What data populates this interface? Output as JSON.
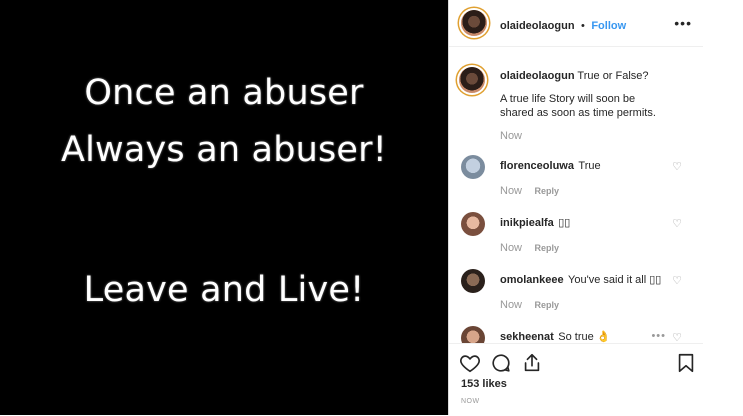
{
  "post": {
    "image_lines": [
      "Once an abuser",
      "Always an abuser!",
      "Leave and Live!"
    ]
  },
  "header": {
    "username": "olaideolaogun",
    "separator": "•",
    "follow_label": "Follow",
    "more_label": "•••"
  },
  "caption": {
    "username": "olaideolaogun",
    "text": "True or False?",
    "body": "A true life Story will soon be shared as soon as time permits.",
    "time": "Now"
  },
  "comments": [
    {
      "username": "florenceoluwa",
      "text": "True",
      "time": "Now",
      "reply_label": "Reply"
    },
    {
      "username": "inikpiealfa",
      "text": "▯▯",
      "time": "Now",
      "reply_label": "Reply"
    },
    {
      "username": "omolankeee",
      "text": "You've said it all ▯▯",
      "time": "Now",
      "reply_label": "Reply"
    },
    {
      "username": "sekheenat",
      "text": "So true 👌",
      "time": "",
      "reply_label": ""
    }
  ],
  "footer": {
    "likes": "153 likes",
    "timestamp": "NOW"
  },
  "icons": {
    "like": "heart-icon",
    "comment": "comment-icon",
    "share": "share-icon",
    "save": "bookmark-icon"
  }
}
